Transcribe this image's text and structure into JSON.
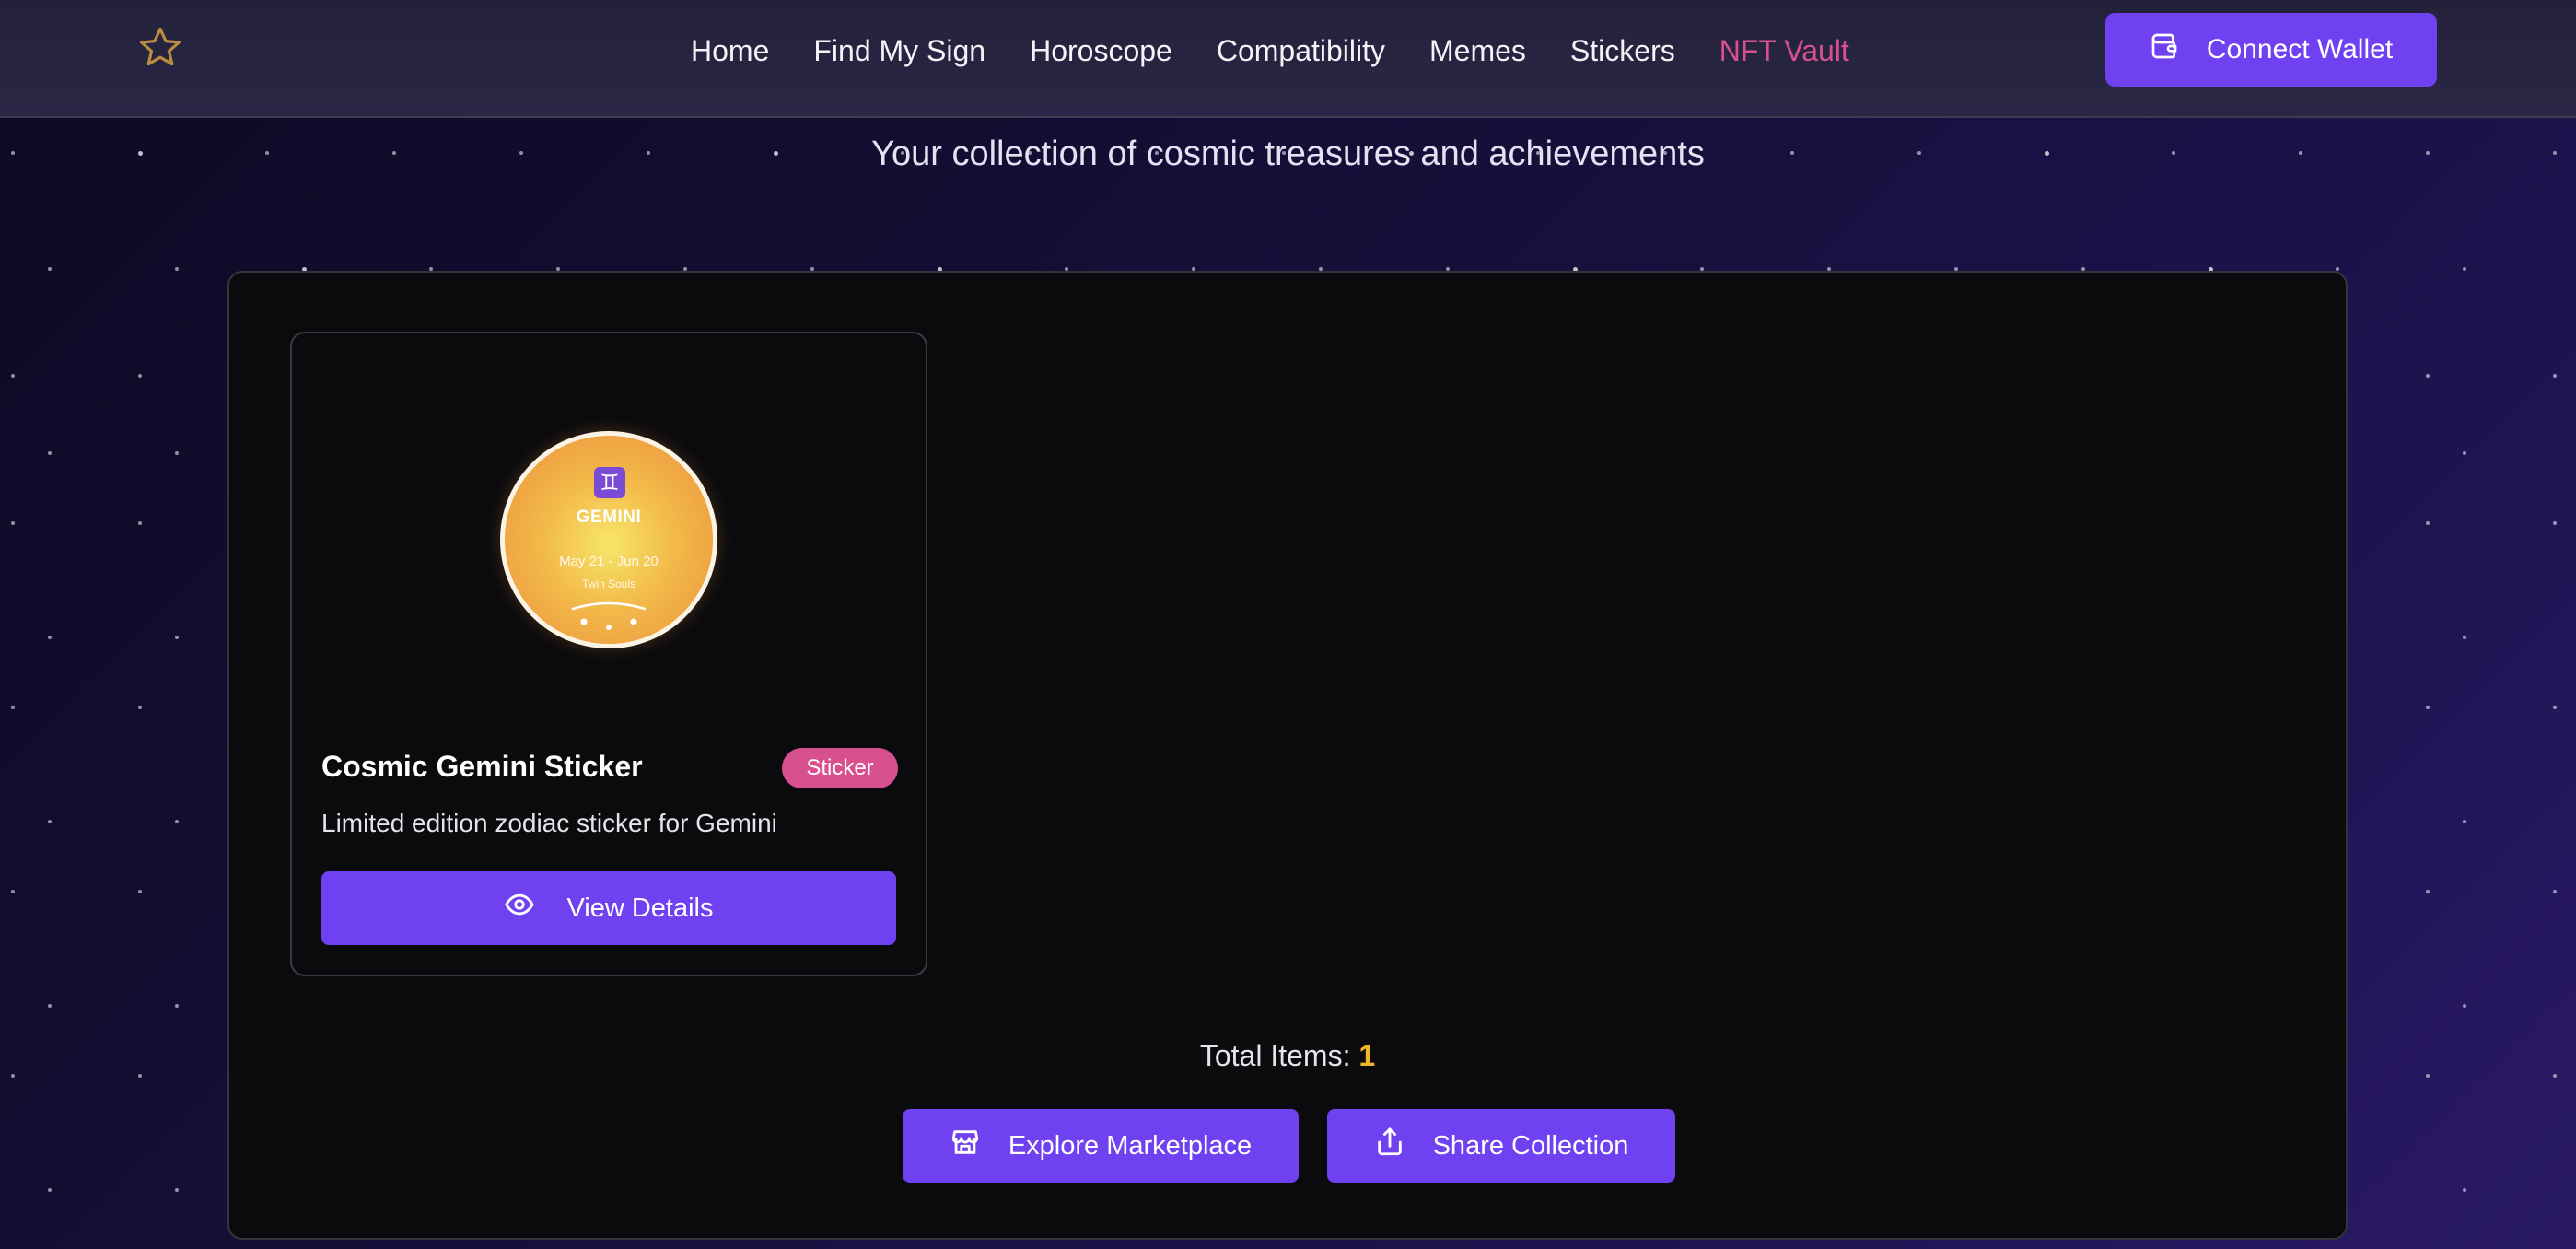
{
  "nav": {
    "logo_icon": "star-outline-icon",
    "links": [
      "Home",
      "Find My Sign",
      "Horoscope",
      "Compatibility",
      "Memes",
      "Stickers",
      "NFT Vault"
    ],
    "active_link": "NFT Vault",
    "connect_label": "Connect Wallet"
  },
  "subtitle": "Your collection of cosmic treasures and achievements",
  "card": {
    "sticker": {
      "sign": "GEMINI",
      "dates": "May 21 - Jun 20",
      "tagline": "Twin Souls",
      "glyph": "♊"
    },
    "title": "Cosmic Gemini Sticker",
    "badge": "Sticker",
    "description": "Limited edition zodiac sticker for Gemini",
    "view_label": "View Details"
  },
  "summary": {
    "total_label": "Total Items:",
    "total_count": "1"
  },
  "actions": {
    "explore_label": "Explore Marketplace",
    "share_label": "Share Collection"
  },
  "colors": {
    "accent": "#7041f0",
    "badge": "#d9508f",
    "active_nav": "#d9508f",
    "count": "#f0b429"
  }
}
